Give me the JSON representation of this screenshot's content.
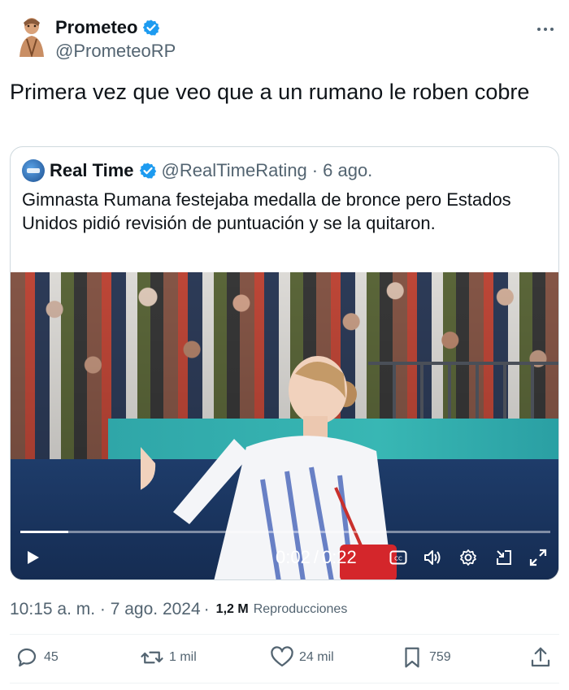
{
  "tweet": {
    "author": {
      "name": "Prometeo",
      "handle": "@PrometeoRP"
    },
    "text": "Primera vez que veo que a un rumano le roben cobre",
    "timestamp": "10:15 a. m. · 7 ago. 2024",
    "views": {
      "count": "1,2 M",
      "label": "Reproducciones"
    },
    "stats": {
      "replies": "45",
      "reposts": "1 mil",
      "likes": "24 mil",
      "bookmarks": "759"
    }
  },
  "quoted": {
    "name": "Real Time",
    "handle": "@RealTimeRating",
    "separator": "·",
    "date": "6 ago.",
    "text": "Gimnasta Rumana festejaba medalla de bronce pero Estados Unidos pidió revisión de puntuación y se la quitaron.",
    "video": {
      "current_time": "0:02",
      "duration": "0:22",
      "time_separator": "/",
      "progress": 0.09
    }
  },
  "colors": {
    "verified": "#1d9bf0",
    "text_primary": "#0f1419",
    "text_secondary": "#536471",
    "border": "#cfd9de"
  },
  "icons": [
    "verified-badge-icon",
    "more-icon",
    "play-icon",
    "closed-captions-icon",
    "volume-icon",
    "settings-icon",
    "dock-icon",
    "fullscreen-icon",
    "reply-icon",
    "repost-icon",
    "like-icon",
    "bookmark-icon",
    "share-icon"
  ]
}
